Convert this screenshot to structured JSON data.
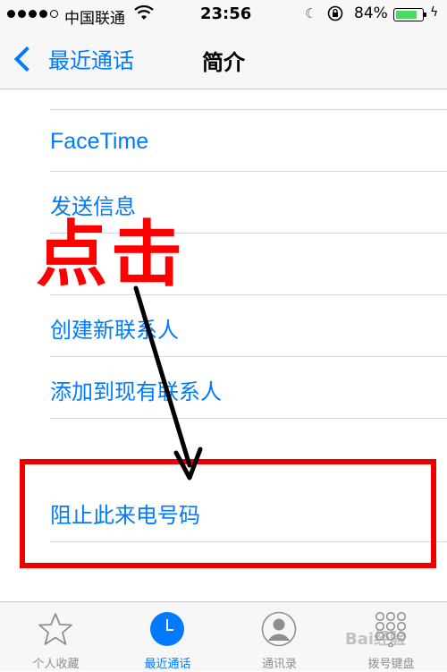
{
  "status_bar": {
    "carrier": "中国联通",
    "time": "23:56",
    "battery_percent_label": "84%",
    "battery_level": 0.84,
    "icons": [
      "signal-dots",
      "wifi-icon",
      "moon-icon",
      "rotation-lock-icon",
      "battery-icon",
      "charging-bolt-icon"
    ]
  },
  "nav": {
    "back_label": "最近通话",
    "title": "简介"
  },
  "list": {
    "items": [
      {
        "label": "FaceTime"
      },
      {
        "label": "发送信息"
      },
      {
        "label": ""
      },
      {
        "label": "创建新联系人"
      },
      {
        "label": "添加到现有联系人"
      },
      {
        "label": "阻止此来电号码"
      }
    ]
  },
  "annotation": {
    "text": "点击",
    "color": "#ff0000"
  },
  "tab_bar": {
    "tabs": [
      {
        "label": "个人收藏",
        "icon": "star-icon",
        "active": false
      },
      {
        "label": "最近通话",
        "icon": "clock-icon",
        "active": true
      },
      {
        "label": "通讯录",
        "icon": "contact-icon",
        "active": false
      },
      {
        "label": "拨号键盘",
        "icon": "keypad-icon",
        "active": false
      }
    ]
  },
  "watermark": "Bai经验",
  "colors": {
    "accent": "#007aff",
    "annotation": "#ff0000",
    "battery": "#4cd964"
  }
}
